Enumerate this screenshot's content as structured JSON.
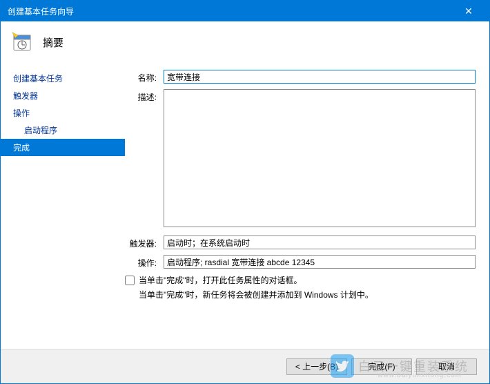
{
  "titlebar": {
    "title": "创建基本任务向导"
  },
  "header": {
    "title": "摘要"
  },
  "sidebar": {
    "items": [
      {
        "label": "创建基本任务",
        "indent": false,
        "active": false
      },
      {
        "label": "触发器",
        "indent": false,
        "active": false
      },
      {
        "label": "操作",
        "indent": false,
        "active": false
      },
      {
        "label": "启动程序",
        "indent": true,
        "active": false
      },
      {
        "label": "完成",
        "indent": false,
        "active": true
      }
    ]
  },
  "form": {
    "name_label": "名称:",
    "name_value": "宽带连接",
    "desc_label": "描述:",
    "desc_value": "",
    "trigger_label": "触发器:",
    "trigger_value": "启动时；在系统启动时",
    "action_label": "操作:",
    "action_value": "启动程序; rasdial 宽带连接 abcde 12345",
    "checkbox_label": "当单击\"完成\"时，打开此任务属性的对话框。",
    "info_text": "当单击\"完成\"时，新任务将会被创建并添加到 Windows 计划中。"
  },
  "footer": {
    "back": "< 上一步(B)",
    "finish": "完成(F)",
    "cancel": "取消"
  },
  "watermark": {
    "text": "白云一键重装系统",
    "sub": "www.baiyunxitong.com"
  }
}
